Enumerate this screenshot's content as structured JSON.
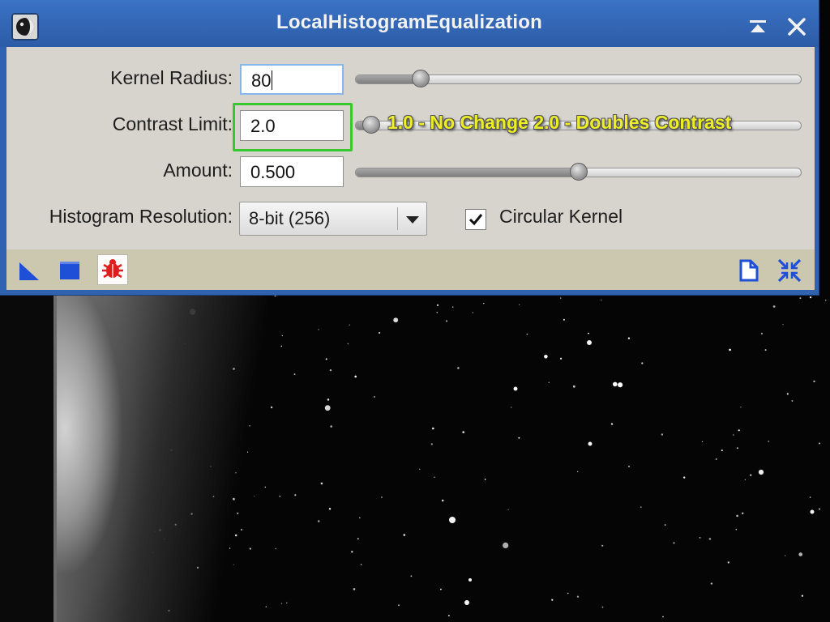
{
  "window": {
    "title": "LocalHistogramEqualization"
  },
  "fields": {
    "kernel_radius": {
      "label": "Kernel Radius:",
      "value": "80",
      "slider_fraction": 0.145
    },
    "contrast_limit": {
      "label": "Contrast Limit:",
      "value": "2.0",
      "slider_fraction": 0.035
    },
    "amount": {
      "label": "Amount:",
      "value": "0.500",
      "slider_fraction": 0.5
    }
  },
  "annotation": {
    "text": "1.0 - No Change  2.0 - Doubles Contrast",
    "color": "#eded28"
  },
  "histogram_resolution": {
    "label": "Histogram Resolution:",
    "selected": "8-bit (256)"
  },
  "circular_kernel": {
    "label": "Circular Kernel",
    "checked": true
  },
  "toolbar": {
    "icons": [
      "new-instance-icon",
      "apply-global-icon",
      "real-time-preview-icon",
      "reset-icon",
      "collapse-icon"
    ]
  },
  "colors": {
    "title_bar": "#2f62b0",
    "panel": "#d6d4cc",
    "toolbar": "#cbc8af",
    "highlight_box": "#35c92f"
  }
}
